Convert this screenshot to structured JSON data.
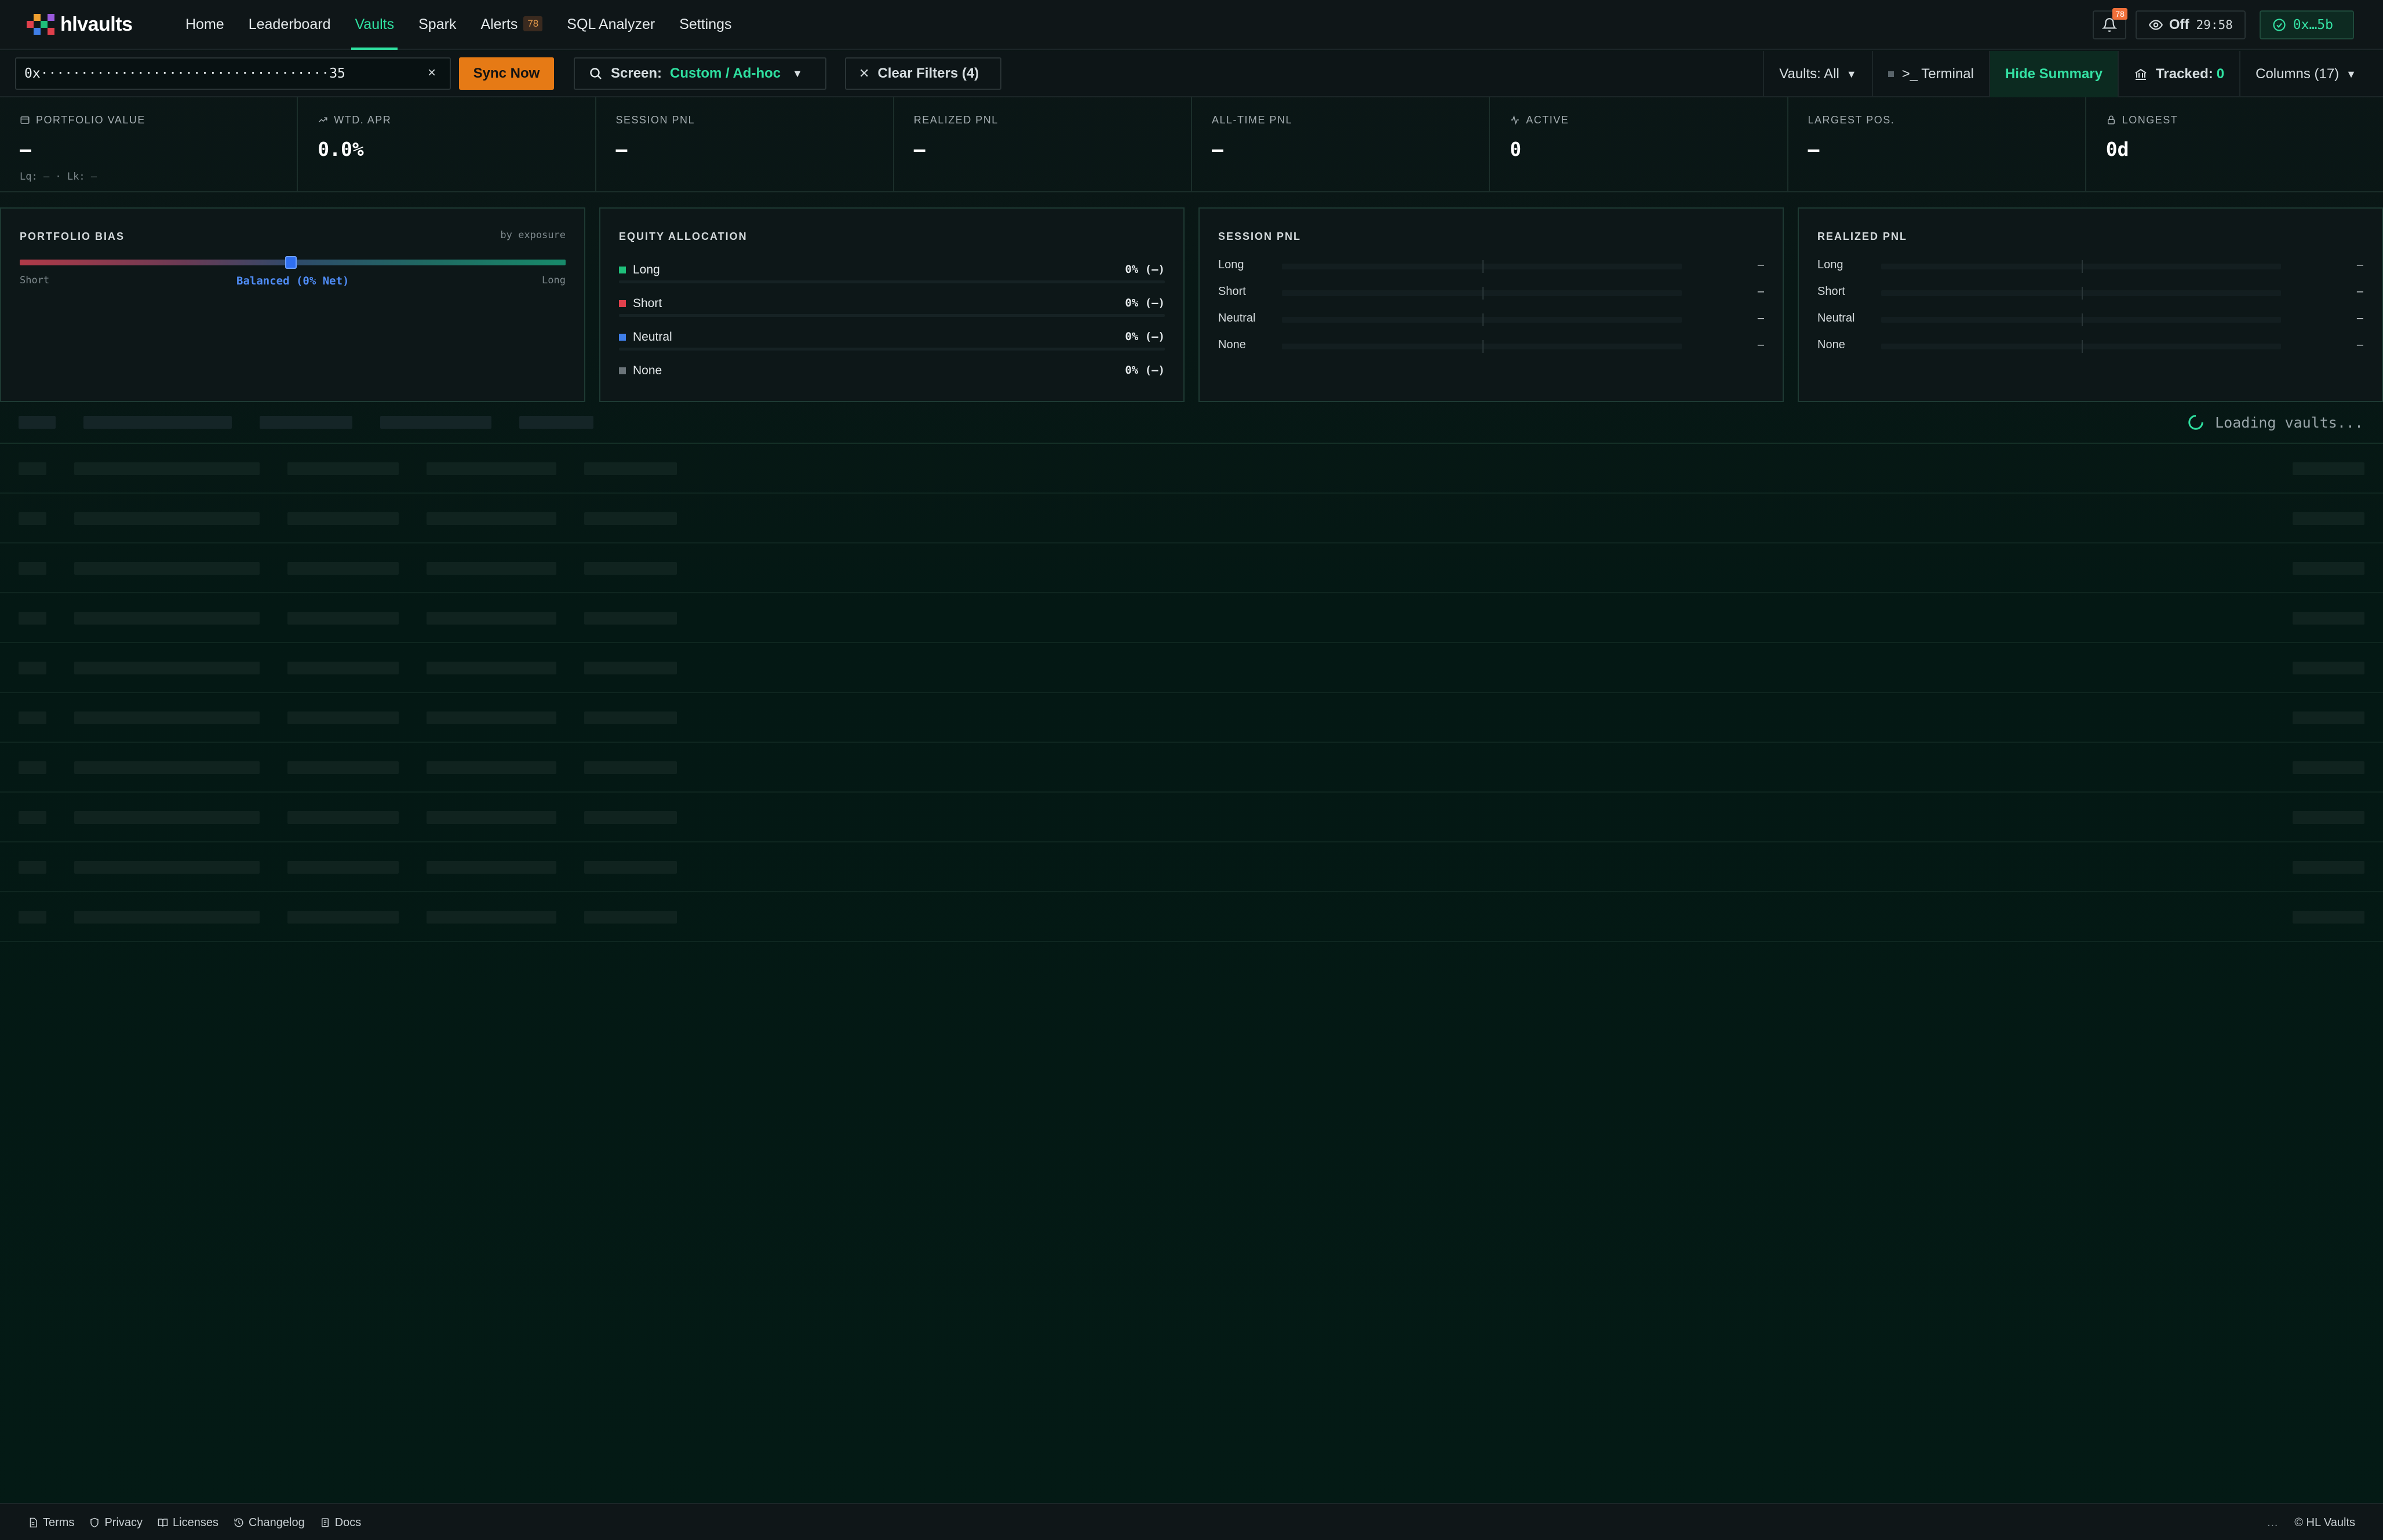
{
  "brand": {
    "name": "hlvaults"
  },
  "nav": {
    "items": [
      {
        "label": "Home",
        "active": false
      },
      {
        "label": "Leaderboard",
        "active": false
      },
      {
        "label": "Vaults",
        "active": true
      },
      {
        "label": "Spark",
        "active": false
      },
      {
        "label": "Alerts",
        "active": false,
        "badge": "78"
      },
      {
        "label": "SQL Analyzer",
        "active": false
      },
      {
        "label": "Settings",
        "active": false
      }
    ],
    "bell_badge": "78",
    "watch": {
      "label": "Off",
      "timer": "29:58",
      "icon": "eye-icon"
    },
    "wallet": {
      "label": "0x…5b",
      "icon": "check-circle-icon"
    }
  },
  "toolbar": {
    "address_value": "0x····································35",
    "clear_icon": "×",
    "sync_label": "Sync Now",
    "screen_label": "Screen:",
    "screen_value": "Custom / Ad-hoc",
    "clear_filters_label": "Clear Filters (4)",
    "vaults_label": "Vaults: All",
    "terminal_label": ">_ Terminal",
    "hide_summary_label": "Hide Summary",
    "tracked_label": "Tracked:",
    "tracked_value": "0",
    "columns_label": "Columns (17)"
  },
  "stats": [
    {
      "label": "PORTFOLIO VALUE",
      "value": "–",
      "sub": "Lq: – · Lk: –",
      "icon": "wallet-icon"
    },
    {
      "label": "WTD. APR",
      "value": "0.0%",
      "icon": "trend-up-icon"
    },
    {
      "label": "SESSION PNL",
      "value": "–"
    },
    {
      "label": "REALIZED PNL",
      "value": "–"
    },
    {
      "label": "ALL-TIME PNL",
      "value": "–"
    },
    {
      "label": "ACTIVE",
      "value": "0",
      "icon": "activity-icon"
    },
    {
      "label": "LARGEST POS.",
      "value": "–"
    },
    {
      "label": "LONGEST",
      "value": "0d",
      "icon": "lock-icon"
    }
  ],
  "bias": {
    "title": "PORTFOLIO BIAS",
    "by": "by exposure",
    "short": "Short",
    "long": "Long",
    "center": "Balanced (0% Net)",
    "net_percent": 0
  },
  "equity": {
    "title": "EQUITY ALLOCATION",
    "rows": [
      {
        "name": "Long",
        "value": "0% (–)",
        "color": "#1fbf7a"
      },
      {
        "name": "Short",
        "value": "0% (–)",
        "color": "#e0404c"
      },
      {
        "name": "Neutral",
        "value": "0% (–)",
        "color": "#3f7ee8"
      },
      {
        "name": "None",
        "value": "0% (–)",
        "color": "#6b7479"
      }
    ]
  },
  "session_pnl": {
    "title": "SESSION PNL",
    "rows": [
      {
        "name": "Long",
        "value": "–"
      },
      {
        "name": "Short",
        "value": "–"
      },
      {
        "name": "Neutral",
        "value": "–"
      },
      {
        "name": "None",
        "value": "–"
      }
    ]
  },
  "realized_pnl": {
    "title": "REALIZED PNL",
    "rows": [
      {
        "name": "Long",
        "value": "–"
      },
      {
        "name": "Short",
        "value": "–"
      },
      {
        "name": "Neutral",
        "value": "–"
      },
      {
        "name": "None",
        "value": "–"
      }
    ]
  },
  "table": {
    "loading_text": "Loading vaults..."
  },
  "footer": {
    "links": [
      {
        "label": "Terms",
        "icon": "document-icon"
      },
      {
        "label": "Privacy",
        "icon": "shield-icon"
      },
      {
        "label": "Licenses",
        "icon": "book-icon"
      },
      {
        "label": "Changelog",
        "icon": "history-icon"
      },
      {
        "label": "Docs",
        "icon": "docs-icon"
      }
    ],
    "dots": "…",
    "copyright": "© HL Vaults"
  }
}
